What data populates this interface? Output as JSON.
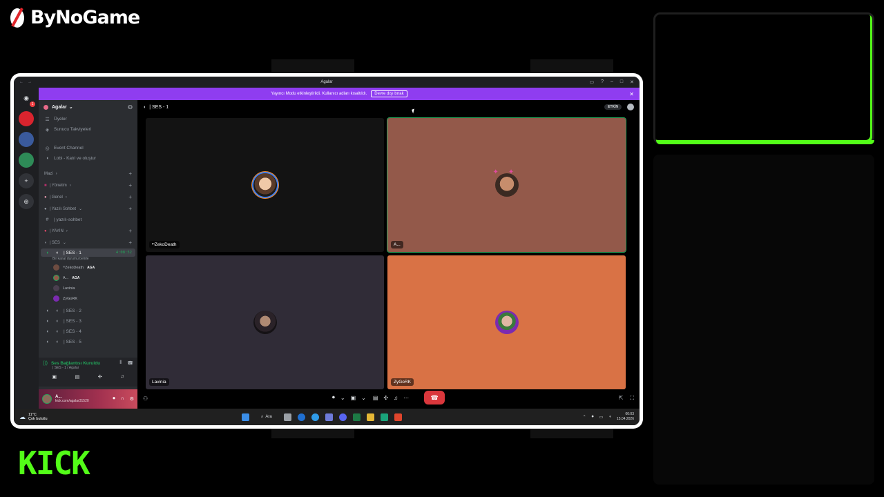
{
  "overlay": {
    "brand_top": "ByNoGame",
    "brand_bottom": "KICK"
  },
  "window": {
    "title": "Agalar",
    "banner_text": "Yayıncı Modu etkinleştirildi. Kullanıcı adları kısaltıldı.",
    "banner_button": "Devre dışı bırak",
    "banner_close": "✕"
  },
  "server": {
    "name": "Agalar",
    "top_items": [
      {
        "icon": "members-icon",
        "label": "Üyeler"
      },
      {
        "icon": "boost-icon",
        "label": "Sunucu Takviyeleri"
      }
    ],
    "event_channel": "Event Channel",
    "lobby_channel": "Lobi - Katıl ve oluştur",
    "categories": [
      "Mazi",
      "| Yönetim",
      "| Genel",
      "| Yazılı Sohbet",
      "| YAYIN",
      "| SES"
    ],
    "text_channel": "| yazılı-sohbet",
    "active_voice": {
      "name": "| SES - 1",
      "timer": "4:08:52",
      "status": "Bir kanal durumu belirle"
    },
    "voice_users": [
      {
        "name": "ᵐZekoDeath",
        "tag": "AGA"
      },
      {
        "name": "A...",
        "tag": "AGA"
      },
      {
        "name": "Lavinia",
        "tag": ""
      },
      {
        "name": "ZyGoRK",
        "tag": ""
      }
    ],
    "other_voice": [
      "| SES - 2",
      "| SES - 3",
      "| SES - 4",
      "| SES - 5"
    ]
  },
  "voice_panel": {
    "title": "Ses Bağlantısı Kuruldu",
    "subtitle": "| SES - 1 / Agalar"
  },
  "user_panel": {
    "name": "A...",
    "subtitle": "kick.com/agalar31520"
  },
  "call": {
    "channel": "| SES - 1",
    "live_pill": "ETKİN",
    "participants": [
      {
        "name": "ᵐZekoDeath",
        "bg": "#131313"
      },
      {
        "name": "A...",
        "bg": "#93594a"
      },
      {
        "name": "Lavinia",
        "bg": "#302c37"
      },
      {
        "name": "ZyGoRK",
        "bg": "#d97245"
      }
    ]
  },
  "taskbar": {
    "temp": "11°C",
    "weather": "Çok bulutlu",
    "search": "Ara",
    "time": "00:03",
    "date": "15.04.2026"
  }
}
